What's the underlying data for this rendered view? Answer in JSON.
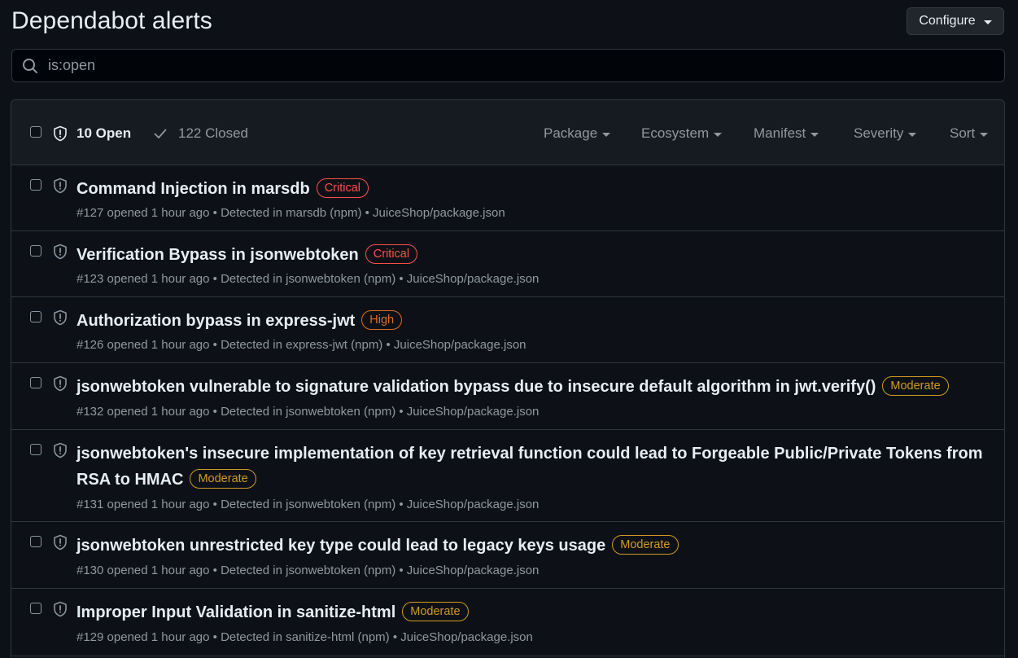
{
  "page": {
    "title": "Dependabot alerts",
    "configure_label": "Configure"
  },
  "search": {
    "value": "is:open"
  },
  "header": {
    "open_label": "10 Open",
    "closed_label": "122 Closed",
    "filters": [
      "Package",
      "Ecosystem",
      "Manifest",
      "Severity",
      "Sort"
    ]
  },
  "colors": {
    "critical": "#f85149",
    "high": "#db6d28",
    "moderate": "#d29922"
  },
  "alerts": [
    {
      "title": "Command Injection in marsdb",
      "severity": "Critical",
      "meta": "#127 opened 1 hour ago • Detected in marsdb (npm) • JuiceShop/package.json"
    },
    {
      "title": "Verification Bypass in jsonwebtoken",
      "severity": "Critical",
      "meta": "#123 opened 1 hour ago • Detected in jsonwebtoken (npm) • JuiceShop/package.json"
    },
    {
      "title": "Authorization bypass in express-jwt",
      "severity": "High",
      "meta": "#126 opened 1 hour ago • Detected in express-jwt (npm) • JuiceShop/package.json"
    },
    {
      "title": "jsonwebtoken vulnerable to signature validation bypass due to insecure default algorithm in jwt.verify()",
      "severity": "Moderate",
      "meta": "#132 opened 1 hour ago • Detected in jsonwebtoken (npm) • JuiceShop/package.json"
    },
    {
      "title": "jsonwebtoken's insecure implementation of key retrieval function could lead to Forgeable Public/Private Tokens from RSA to HMAC",
      "severity": "Moderate",
      "meta": "#131 opened 1 hour ago • Detected in jsonwebtoken (npm) • JuiceShop/package.json"
    },
    {
      "title": "jsonwebtoken unrestricted key type could lead to legacy keys usage",
      "severity": "Moderate",
      "meta": "#130 opened 1 hour ago • Detected in jsonwebtoken (npm) • JuiceShop/package.json"
    },
    {
      "title": "Improper Input Validation in sanitize-html",
      "severity": "Moderate",
      "meta": "#129 opened 1 hour ago • Detected in sanitize-html (npm) • JuiceShop/package.json"
    }
  ]
}
